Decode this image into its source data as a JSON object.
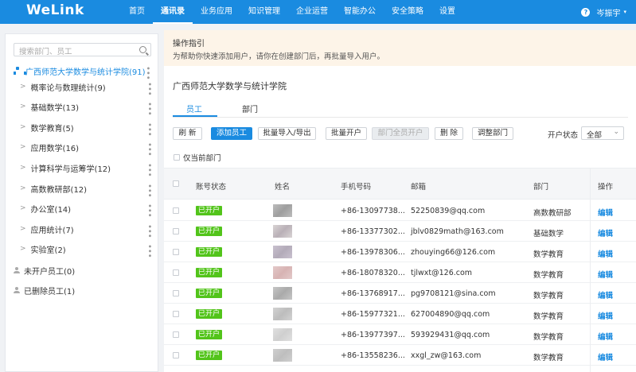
{
  "app": {
    "logo": "WeLink"
  },
  "nav": {
    "items": [
      "首页",
      "通讯录",
      "业务应用",
      "知识管理",
      "企业运营",
      "智能办公",
      "安全策略",
      "设置"
    ],
    "active_index": 1
  },
  "user": {
    "help_icon": "?",
    "name": "岑振宇",
    "caret": "▾"
  },
  "sidebar": {
    "search_placeholder": "搜索部门、员工",
    "root": {
      "label": "广西师范大学数学与统计学院(91)"
    },
    "items": [
      {
        "label": "概率论与数理统计(9)"
      },
      {
        "label": "基础数学(13)"
      },
      {
        "label": "数学教育(5)"
      },
      {
        "label": "应用数学(16)"
      },
      {
        "label": "计算科学与运筹学(12)"
      },
      {
        "label": "高数教研部(12)"
      },
      {
        "label": "办公室(14)"
      },
      {
        "label": "应用统计(7)"
      },
      {
        "label": "实验室(2)"
      }
    ],
    "extra": [
      {
        "label": "未开户员工(0)"
      },
      {
        "label": "已删除员工(1)"
      }
    ]
  },
  "notice": {
    "title": "操作指引",
    "text": "为帮助你快速添加用户，请你在创建部门后，再批量导入用户。"
  },
  "main": {
    "dept_title": "广西师范大学数学与统计学院",
    "tabs": [
      "员工",
      "部门"
    ],
    "buttons": {
      "refresh": "刷 新",
      "add": "添加员工",
      "import_export": "批量导入/导出",
      "batch_open": "批量开户",
      "dept_open_all": "部门全员开户",
      "delete": "删 除",
      "adjust": "调整部门"
    },
    "status_filter": {
      "label": "开户状态",
      "value": "全部"
    },
    "only_current_label": "仅当前部门"
  },
  "table": {
    "headers": [
      "账号状态",
      "姓名",
      "手机号码",
      "邮箱",
      "部门",
      "操作"
    ],
    "rows": [
      {
        "status": "已开户",
        "phone": "+86-13097738...",
        "email": "52250839@qq.com",
        "dept": "高数教研部",
        "action": "编辑",
        "blur": [
          "#bdbdbd",
          "#9e9e9e"
        ]
      },
      {
        "status": "已开户",
        "phone": "+86-13377302...",
        "email": "jblv0829math@163.com",
        "dept": "基础数学",
        "action": "编辑",
        "blur": [
          "#d9d4d4",
          "#b9b0b7"
        ]
      },
      {
        "status": "已开户",
        "phone": "+86-13978306...",
        "email": "zhouying66@126.com",
        "dept": "数学教育",
        "action": "编辑",
        "blur": [
          "#c9c1cf",
          "#b3abb9"
        ]
      },
      {
        "status": "已开户",
        "phone": "+86-18078320...",
        "email": "tjlwxt@126.com",
        "dept": "数学教育",
        "action": "编辑",
        "blur": [
          "#e3c9c9",
          "#d7b3b3"
        ]
      },
      {
        "status": "已开户",
        "phone": "+86-13768917...",
        "email": "pg9708121@sina.com",
        "dept": "数学教育",
        "action": "编辑",
        "blur": [
          "#c6c6c6",
          "#aaaaaa"
        ]
      },
      {
        "status": "已开户",
        "phone": "+86-15977321...",
        "email": "627004890@qq.com",
        "dept": "数学教育",
        "action": "编辑",
        "blur": [
          "#d2d2d2",
          "#bdbdbd"
        ]
      },
      {
        "status": "已开户",
        "phone": "+86-13977397...",
        "email": "593929431@qq.com",
        "dept": "数学教育",
        "action": "编辑",
        "blur": [
          "#e0e0e0",
          "#cfcfcf"
        ]
      },
      {
        "status": "已开户",
        "phone": "+86-13558236...",
        "email": "xxgl_zw@163.com",
        "dept": "数学教育",
        "action": "编辑",
        "blur": [
          "#cfcfcf",
          "#bebebe"
        ]
      }
    ]
  },
  "colors": {
    "primary": "#1a8be0",
    "badge_green": "#52c41a",
    "notice_bg": "#fdf4e8"
  }
}
